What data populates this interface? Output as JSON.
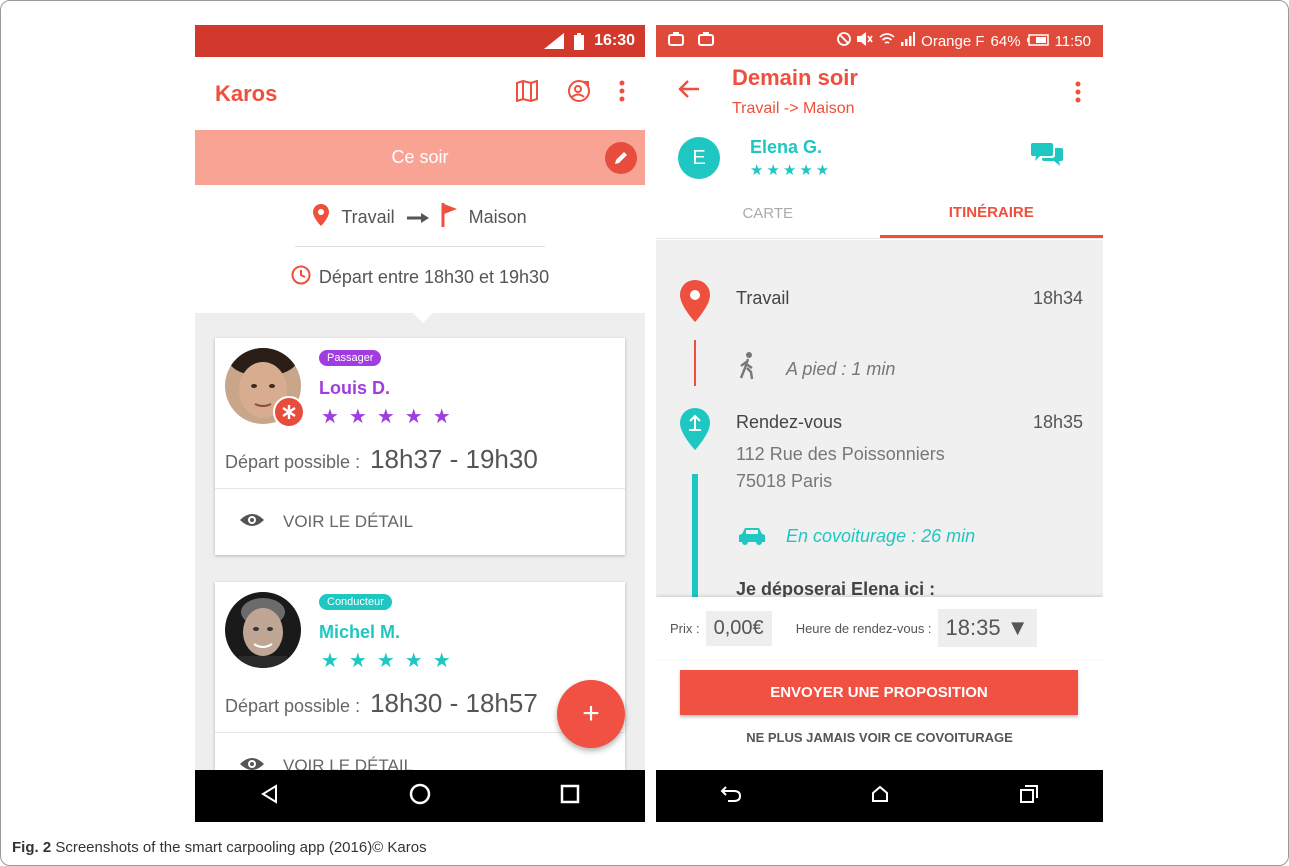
{
  "colors": {
    "accent": "#ef4f3d",
    "status_bar_left": "#d2382b",
    "banner": "#f9a394",
    "passenger": "#a13de0",
    "driver": "#1fc7c2"
  },
  "left": {
    "status_time": "16:30",
    "app_title": "Karos",
    "icons": [
      "map-icon",
      "account-switch-icon",
      "more-vert-icon"
    ],
    "banner_label": "Ce soir",
    "route_from": "Travail",
    "route_to": "Maison",
    "depart_text": "Départ entre 18h30 et 19h30",
    "rides": [
      {
        "role": "Passager",
        "name": "Louis D.",
        "stars": "★★★★★",
        "depart_label": "Départ possible :",
        "depart_value": "18h37 - 19h30",
        "action_label": "VOIR LE DÉTAIL"
      },
      {
        "role": "Conducteur",
        "name": "Michel M.",
        "stars": "★★★★★",
        "depart_label": "Départ possible :",
        "depart_value": "18h30 - 18h57",
        "action_label": "VOIR LE DÉTAIL"
      }
    ],
    "fab_label": "+"
  },
  "right": {
    "status_carrier": "Orange F",
    "status_battery": "64%",
    "status_time": "11:50",
    "title": "Demain soir",
    "subtitle": "Travail -> Maison",
    "driver_initial": "E",
    "driver_name": "Elena G.",
    "driver_stars": "★★★★★",
    "tabs": [
      "CARTE",
      "ITINÉRAIRE"
    ],
    "itinerary": {
      "stop1_title": "Travail",
      "stop1_time": "18h34",
      "walk": "A pied : 1 min",
      "stop2_title": "Rendez-vous",
      "stop2_time": "18h35",
      "stop2_address1": "112 Rue des Poissonniers",
      "stop2_address2": "75018 Paris",
      "carpool": "En covoiturage : 26 min",
      "dropoff": "Je déposerai Elena ici :"
    },
    "price_label": "Prix :",
    "price_value": "0,00€",
    "meet_label": "Heure de rendez-vous :",
    "meet_value": "18:35 ▼",
    "send_button": "ENVOYER UNE PROPOSITION",
    "never_link": "NE PLUS JAMAIS VOIR CE COVOITURAGE"
  },
  "caption": {
    "fig": "Fig. 2",
    "text": " Screenshots of the smart carpooling app (2016)© Karos"
  }
}
